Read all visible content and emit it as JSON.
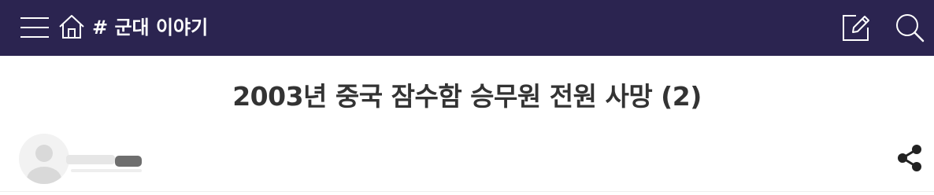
{
  "header": {
    "board_title": "# 군대 이야기",
    "background": "#2b2450",
    "icons": [
      "menu-icon",
      "home-icon",
      "write-icon",
      "search-icon"
    ]
  },
  "post": {
    "title": "2003년 중국 잠수함 승무원 전원 사망 (2)",
    "author": {
      "avatar": "default-avatar",
      "name_blurred": true
    },
    "share_icon": "share-icon"
  }
}
